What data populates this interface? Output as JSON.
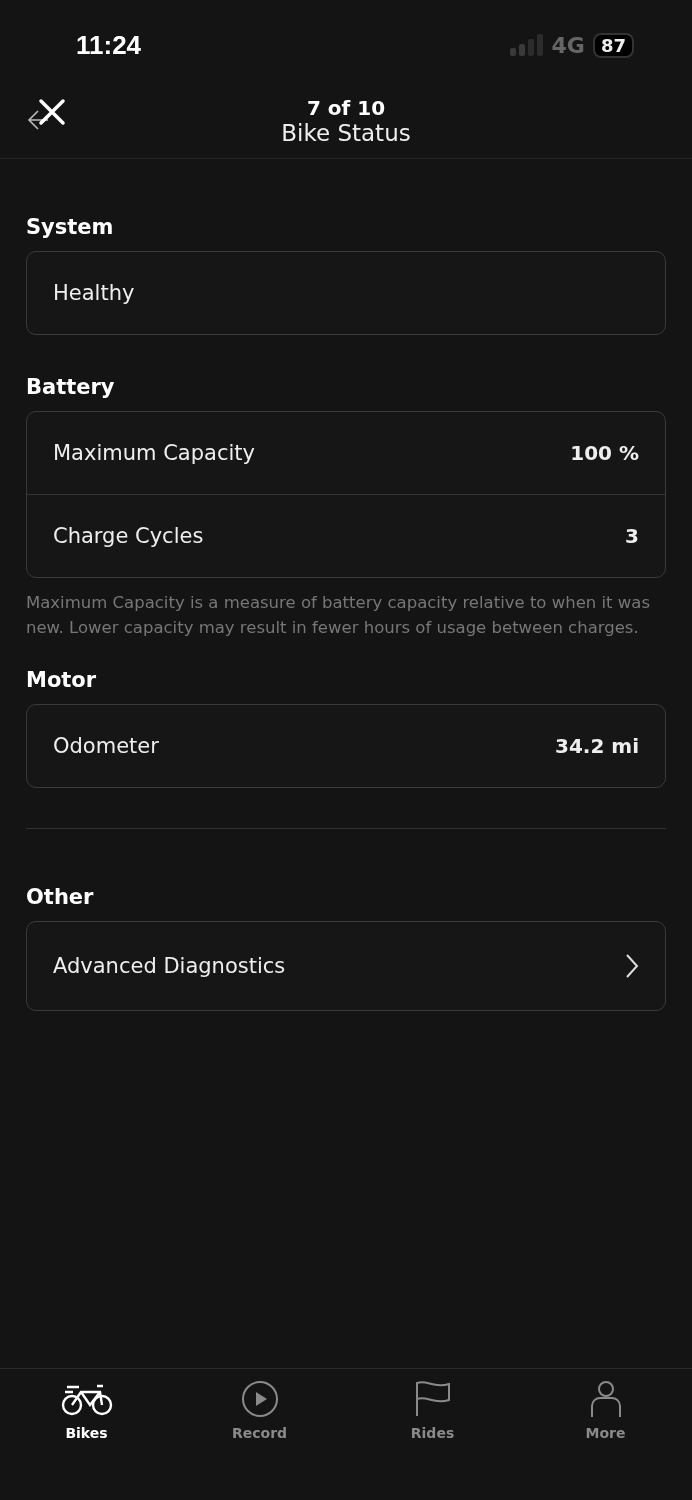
{
  "status_bar": {
    "time": "11:24",
    "network": "4G",
    "battery": "87"
  },
  "viewer": {
    "counter": "7 of 10"
  },
  "header": {
    "title": "Bike Status"
  },
  "sections": [
    {
      "title": "System",
      "rows": [
        {
          "kind": "text",
          "label": "Healthy"
        }
      ]
    },
    {
      "title": "Battery",
      "rows": [
        {
          "kind": "value",
          "label": "Maximum Capacity",
          "value": "100 %"
        },
        {
          "kind": "value",
          "label": "Charge Cycles",
          "value": "3"
        }
      ],
      "note": "Maximum Capacity is a measure of battery capacity relative to when it was new. Lower capacity may result in fewer hours of usage between charges."
    },
    {
      "title": "Motor",
      "rows": [
        {
          "kind": "value",
          "label": "Odometer",
          "value": "34.2 mi"
        }
      ],
      "divider_after": true
    },
    {
      "title": "Other",
      "rows": [
        {
          "kind": "link",
          "label": "Advanced Diagnostics"
        }
      ]
    }
  ],
  "tabs": [
    {
      "label": "Bikes",
      "kind": "bike",
      "selected": true
    },
    {
      "label": "Record",
      "kind": "play",
      "selected": false
    },
    {
      "label": "Rides",
      "kind": "flag",
      "selected": false
    },
    {
      "label": "More",
      "kind": "person",
      "selected": false
    }
  ]
}
